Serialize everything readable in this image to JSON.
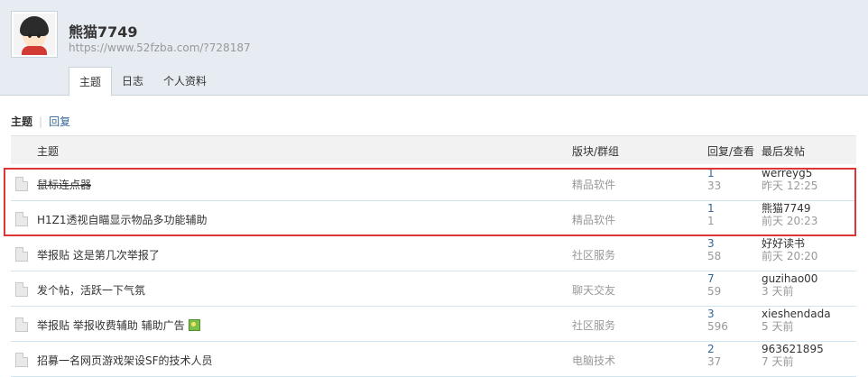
{
  "profile": {
    "username": "熊猫7749",
    "url": "https://www.52fzba.com/?728187"
  },
  "tabs": [
    {
      "label": "主题",
      "active": true
    },
    {
      "label": "日志",
      "active": false
    },
    {
      "label": "个人资料",
      "active": false
    }
  ],
  "subnav": {
    "active": "主题",
    "other": "回复"
  },
  "table": {
    "headers": {
      "topic": "主题",
      "forum": "版块/群组",
      "replies_views": "回复/查看",
      "last_post": "最后发帖"
    },
    "rows": [
      {
        "title": "鼠标连点器",
        "forum": "精品软件",
        "replies": "1",
        "views": "33",
        "last_user": "werreyg5",
        "last_time": "昨天 12:25",
        "strikethrough": true,
        "has_image": false
      },
      {
        "title": "H1Z1透视自瞄显示物品多功能辅助",
        "forum": "精品软件",
        "replies": "1",
        "views": "1",
        "last_user": "熊猫7749",
        "last_time": "前天 20:23",
        "strikethrough": false,
        "has_image": false
      },
      {
        "title": "举报贴 这是第几次举报了",
        "forum": "社区服务",
        "replies": "3",
        "views": "58",
        "last_user": "好好读书",
        "last_time": "前天 20:20",
        "strikethrough": false,
        "has_image": false
      },
      {
        "title": "发个帖，活跃一下气氛",
        "forum": "聊天交友",
        "replies": "7",
        "views": "59",
        "last_user": "guzihao00",
        "last_time": "3 天前",
        "strikethrough": false,
        "has_image": false
      },
      {
        "title": "举报贴 举报收费辅助 辅助广告",
        "forum": "社区服务",
        "replies": "3",
        "views": "596",
        "last_user": "xieshendada",
        "last_time": "5 天前",
        "strikethrough": false,
        "has_image": true
      },
      {
        "title": "招募一名网页游戏架设SF的技术人员",
        "forum": "电脑技术",
        "replies": "2",
        "views": "37",
        "last_user": "963621895",
        "last_time": "7 天前",
        "strikethrough": false,
        "has_image": false
      }
    ]
  },
  "highlight_color": "#e03535",
  "link_color": "#336699"
}
